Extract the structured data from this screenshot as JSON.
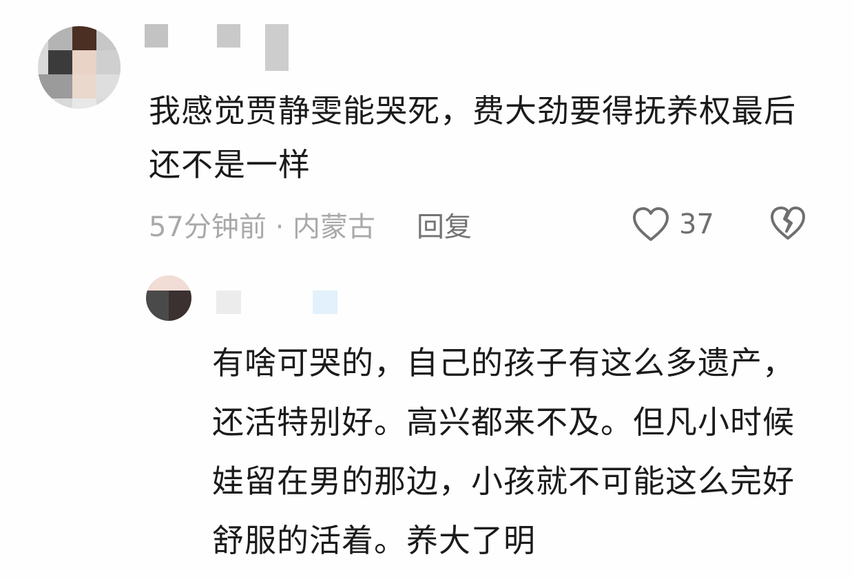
{
  "comment": {
    "text": "我感觉贾静雯能哭死，费大劲要得抚养权最后还不是一样",
    "time_location": "57分钟前 · 内蒙古",
    "reply_label": "回复",
    "like_count": "37"
  },
  "reply": {
    "text": "有啥可哭的，自己的孩子有这么多遗产，还活特别好。高兴都来不及。但凡小时候娃留在男的那边，小孩就不可能这么完好舒服的活着。养大了明"
  },
  "icons": {
    "like": "heart-outline-icon",
    "dislike": "broken-heart-icon"
  },
  "colors": {
    "text_primary": "#1b1b1b",
    "text_meta": "#a9a9a9",
    "reply_button": "#737373"
  }
}
